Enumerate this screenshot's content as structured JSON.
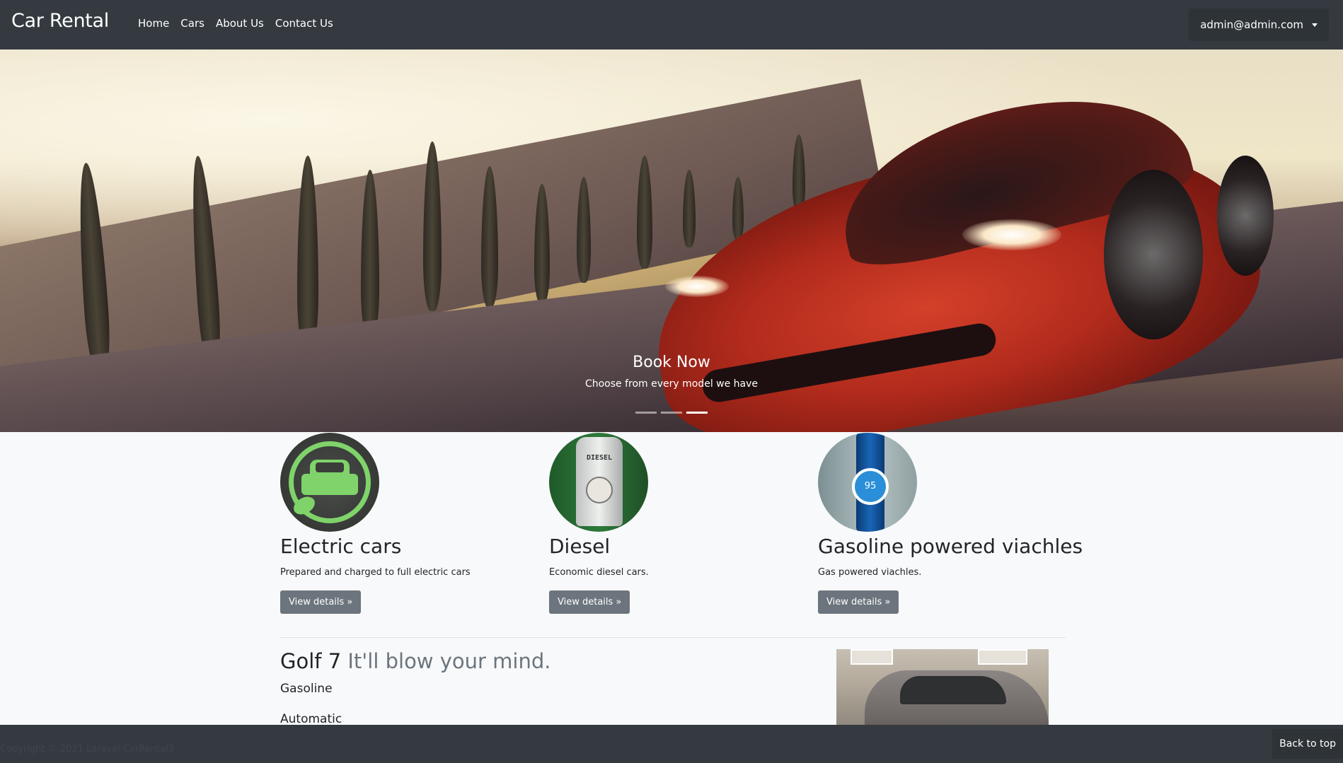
{
  "navbar": {
    "brand": "Car Rental",
    "links": [
      "Home",
      "Cars",
      "About Us",
      "Contact Us"
    ],
    "user": "admin@admin.com"
  },
  "carousel": {
    "caption_title": "Book Now",
    "caption_text": "Choose from every model we have",
    "slide_count": 3,
    "active_slide": 3
  },
  "categories": [
    {
      "title": "Electric cars",
      "text": "Prepared and charged to full electric cars",
      "button": "View details »",
      "icon": "electric-car-icon"
    },
    {
      "title": "Diesel",
      "text": "Economic diesel cars.",
      "button": "View details »",
      "icon": "diesel-pump-icon",
      "pump_label": "DIESEL"
    },
    {
      "title": "Gasoline powered viachles",
      "text": "Gas powered viachles.",
      "button": "View details »",
      "icon": "fuel-nozzle-icon",
      "badge": "Super 95"
    }
  ],
  "featured": {
    "model": "Golf 7",
    "tagline": "It'll blow your mind.",
    "fuel": "Gasoline",
    "transmission": "Automatic"
  },
  "footer": {
    "copyright": "Copyright © 2021 Laravel CarRental3",
    "back_to_top": "Back to top"
  },
  "colors": {
    "navbar": "#343a40",
    "button": "#6c757d",
    "page_bg": "#f8f9fa",
    "electric_green": "#7fd36a"
  }
}
